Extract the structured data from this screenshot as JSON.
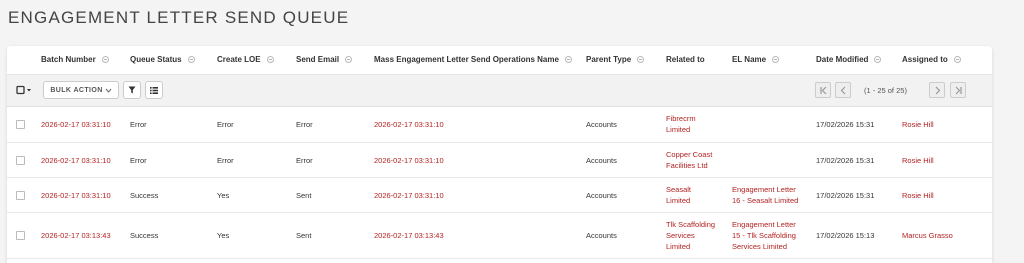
{
  "page": {
    "title": "ENGAGEMENT LETTER SEND QUEUE"
  },
  "columns": {
    "batch_number": "Batch Number",
    "queue_status": "Queue Status",
    "create_loe": "Create LOE",
    "send_email": "Send Email",
    "mass_name": "Mass Engagement Letter Send Operations Name",
    "parent_type": "Parent Type",
    "related_to": "Related to",
    "el_name": "EL Name",
    "date_modified": "Date Modified",
    "assigned_to": "Assigned to"
  },
  "toolbar": {
    "select_icon": "checkbox-dropdown-icon",
    "bulk_action_label": "BULK ACTION",
    "filter_icon": "filter-icon",
    "columns_icon": "list-icon",
    "pagination_text": "(1 - 25 of 25)"
  },
  "rows": [
    {
      "batch": "2026-02-17 03:31:10",
      "status": "Error",
      "create_loe": "Error",
      "send_email": "Error",
      "mass_name": "2026-02-17 03:31:10",
      "parent_type": "Accounts",
      "related_l1": "Fibrecrm",
      "related_l2": "Limited",
      "related_l3": "",
      "el_l1": "",
      "el_l2": "",
      "el_l3": "",
      "date": "17/02/2026 15:31",
      "assigned": "Rosie Hill"
    },
    {
      "batch": "2026-02-17 03:31:10",
      "status": "Error",
      "create_loe": "Error",
      "send_email": "Error",
      "mass_name": "2026-02-17 03:31:10",
      "parent_type": "Accounts",
      "related_l1": "Copper Coast",
      "related_l2": "Facilities Ltd",
      "related_l3": "",
      "el_l1": "",
      "el_l2": "",
      "el_l3": "",
      "date": "17/02/2026 15:31",
      "assigned": "Rosie Hill"
    },
    {
      "batch": "2026-02-17 03:31:10",
      "status": "Success",
      "create_loe": "Yes",
      "send_email": "Sent",
      "mass_name": "2026-02-17 03:31:10",
      "parent_type": "Accounts",
      "related_l1": "Seasalt",
      "related_l2": "Limited",
      "related_l3": "",
      "el_l1": "Engagement Letter",
      "el_l2": "16 - Seasalt Limited",
      "el_l3": "",
      "date": "17/02/2026 15:31",
      "assigned": "Rosie Hill"
    },
    {
      "batch": "2026-02-17 03:13:43",
      "status": "Success",
      "create_loe": "Yes",
      "send_email": "Sent",
      "mass_name": "2026-02-17 03:13:43",
      "parent_type": "Accounts",
      "related_l1": "Tlk Scaffolding",
      "related_l2": "Services",
      "related_l3": "Limited",
      "el_l1": "Engagement Letter",
      "el_l2": "15 - Tlk Scaffolding",
      "el_l3": "Services Limited",
      "date": "17/02/2026 15:13",
      "assigned": "Marcus Grasso"
    }
  ]
}
